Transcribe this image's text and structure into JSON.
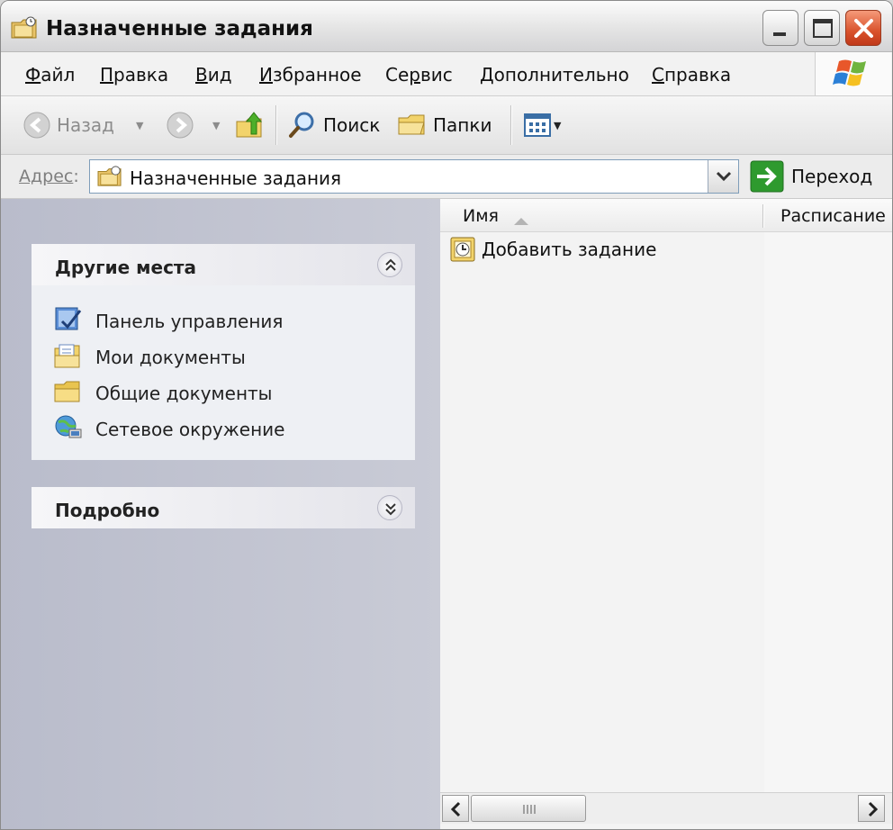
{
  "window": {
    "title": "Назначенные задания"
  },
  "menu": {
    "items": [
      {
        "acc": "Ф",
        "rest": "айл"
      },
      {
        "acc": "П",
        "rest": "равка"
      },
      {
        "acc": "В",
        "rest": "ид"
      },
      {
        "pre": "",
        "acc": "И",
        "rest": "збранное"
      },
      {
        "pre": "Се",
        "acc": "р",
        "rest": "вис"
      },
      {
        "pre": "",
        "acc": "Д",
        "rest": "ополнительно"
      },
      {
        "pre": "",
        "acc": "С",
        "rest": "правка"
      }
    ]
  },
  "toolbar": {
    "back_label": "Назад",
    "search_label": "Поиск",
    "folders_label": "Папки"
  },
  "address": {
    "label_acc": "Адрес",
    "label_colon": ":",
    "value": "Назначенные задания",
    "go_label": "Переход"
  },
  "left": {
    "other_places": {
      "title": "Другие места",
      "items": [
        {
          "label": "Панель управления",
          "icon": "control-panel-icon"
        },
        {
          "label": "Мои документы",
          "icon": "my-documents-icon"
        },
        {
          "label": "Общие документы",
          "icon": "shared-documents-icon"
        },
        {
          "label": "Сетевое окружение",
          "icon": "network-places-icon"
        }
      ]
    },
    "details": {
      "title": "Подробно"
    }
  },
  "list": {
    "columns": [
      "Имя",
      "Расписание"
    ],
    "items": [
      {
        "label": "Добавить задание",
        "icon": "add-task-icon"
      }
    ]
  },
  "colors": {
    "left_pane": "#c2c4d0",
    "go_green": "#2e9a2e",
    "close_red": "#d9522c"
  }
}
